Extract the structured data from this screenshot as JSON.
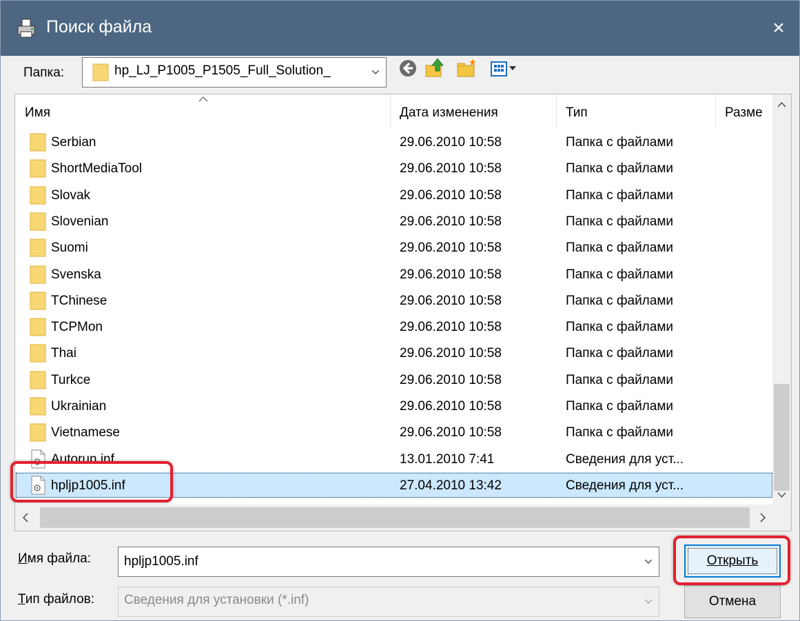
{
  "window": {
    "title": "Поиск файла",
    "close_glyph": "×"
  },
  "folder_row": {
    "label": "Папка:",
    "current_folder": "hp_LJ_P1005_P1505_Full_Solution_"
  },
  "columns": {
    "name": "Имя",
    "date": "Дата изменения",
    "type": "Тип",
    "size": "Разме"
  },
  "files": [
    {
      "name": "Serbian",
      "date": "29.06.2010 10:58",
      "type": "Папка с файлами",
      "icon": "folder-icon"
    },
    {
      "name": "ShortMediaTool",
      "date": "29.06.2010 10:58",
      "type": "Папка с файлами",
      "icon": "folder-icon"
    },
    {
      "name": "Slovak",
      "date": "29.06.2010 10:58",
      "type": "Папка с файлами",
      "icon": "folder-icon"
    },
    {
      "name": "Slovenian",
      "date": "29.06.2010 10:58",
      "type": "Папка с файлами",
      "icon": "folder-icon"
    },
    {
      "name": "Suomi",
      "date": "29.06.2010 10:58",
      "type": "Папка с файлами",
      "icon": "folder-icon"
    },
    {
      "name": "Svenska",
      "date": "29.06.2010 10:58",
      "type": "Папка с файлами",
      "icon": "folder-icon"
    },
    {
      "name": "TChinese",
      "date": "29.06.2010 10:58",
      "type": "Папка с файлами",
      "icon": "folder-icon"
    },
    {
      "name": "TCPMon",
      "date": "29.06.2010 10:58",
      "type": "Папка с файлами",
      "icon": "folder-icon"
    },
    {
      "name": "Thai",
      "date": "29.06.2010 10:58",
      "type": "Папка с файлами",
      "icon": "folder-icon"
    },
    {
      "name": "Turkce",
      "date": "29.06.2010 10:58",
      "type": "Папка с файлами",
      "icon": "folder-icon"
    },
    {
      "name": "Ukrainian",
      "date": "29.06.2010 10:58",
      "type": "Папка с файлами",
      "icon": "folder-icon"
    },
    {
      "name": "Vietnamese",
      "date": "29.06.2010 10:58",
      "type": "Папка с файлами",
      "icon": "folder-icon"
    },
    {
      "name": "Autorun.inf",
      "date": "13.01.2010 7:41",
      "type": "Сведения для уст...",
      "icon": "inf-file-icon"
    },
    {
      "name": "hpljp1005.inf",
      "date": "27.04.2010 13:42",
      "type": "Сведения для уст...",
      "icon": "inf-file-icon",
      "selected": true
    }
  ],
  "filename": {
    "label": "Имя файла:",
    "value": "hpljp1005.inf"
  },
  "filetype": {
    "label": "Тип файлов:",
    "value": "Сведения для установки (*.inf)"
  },
  "buttons": {
    "open": "Открыть",
    "cancel": "Отмена"
  },
  "colors": {
    "titlebar": "#4d6782",
    "selection": "#cce8ff",
    "highlight": "#e3202f",
    "folder": "#f8d775"
  }
}
